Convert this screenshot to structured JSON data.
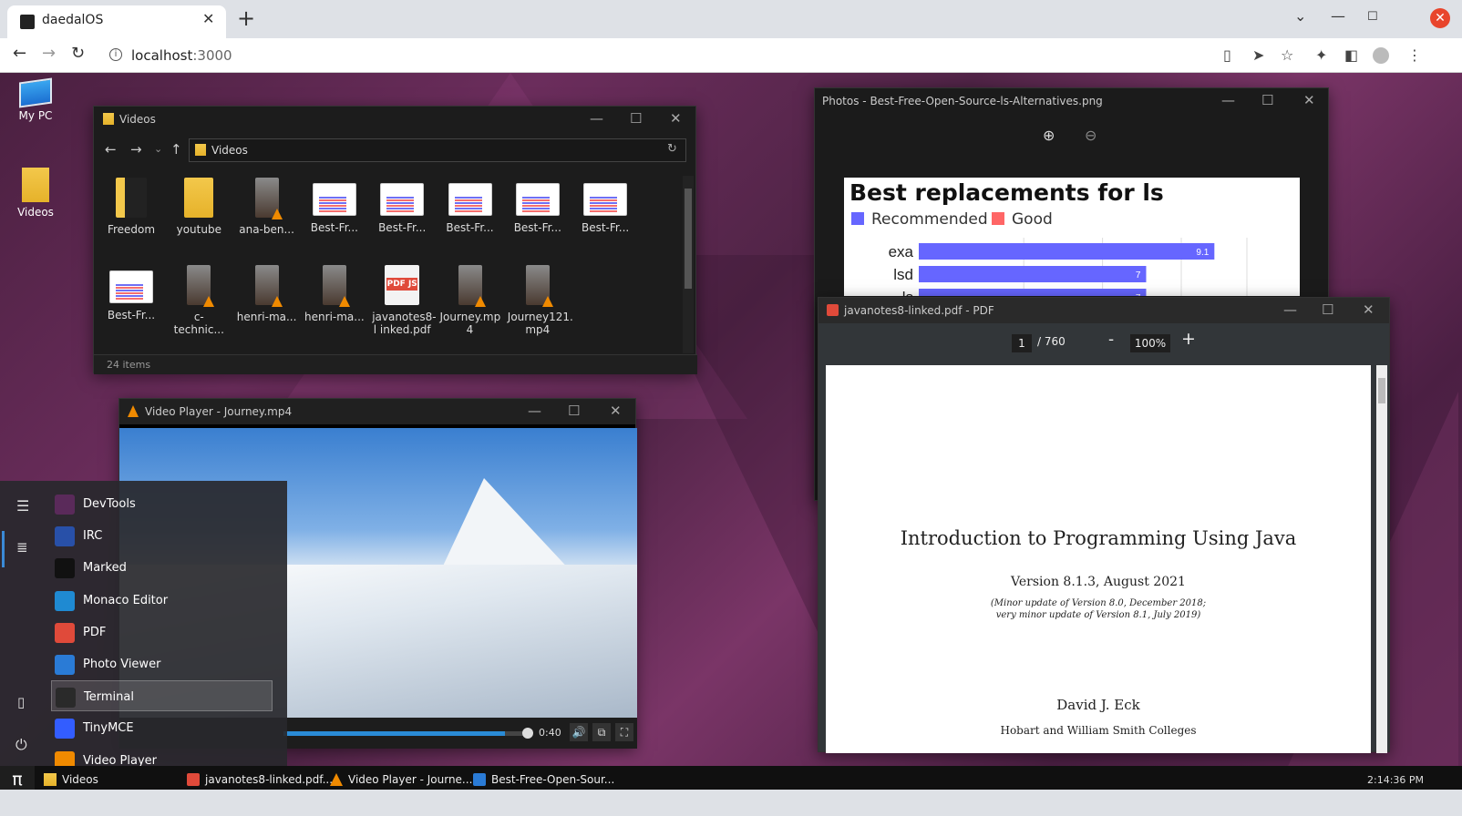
{
  "browser": {
    "tab_title": "daedalOS",
    "url_host": "localhost",
    "url_port": ":3000"
  },
  "desktop_icons": [
    {
      "label": "My PC"
    },
    {
      "label": "Videos"
    }
  ],
  "explorer": {
    "title": "Videos",
    "path": "Videos",
    "status": "24 items",
    "items": [
      {
        "label": "Freedom"
      },
      {
        "label": "youtube"
      },
      {
        "label": "ana-ben..."
      },
      {
        "label": "Best-Fr..."
      },
      {
        "label": "Best-Fr..."
      },
      {
        "label": "Best-Fr..."
      },
      {
        "label": "Best-Fr..."
      },
      {
        "label": "Best-Fr..."
      },
      {
        "label": "Best-Fr..."
      },
      {
        "label": "c-technic..."
      },
      {
        "label": "henri-ma..."
      },
      {
        "label": "henri-ma..."
      },
      {
        "label": "javanotes8-l inked.pdf"
      },
      {
        "label": "Journey.mp 4"
      },
      {
        "label": "Journey121. mp4"
      }
    ]
  },
  "photos": {
    "title": "Photos - Best-Free-Open-Source-ls-Alternatives.png",
    "chart_title": "Best replacements for ls",
    "legend": [
      "Recommended",
      "Good"
    ]
  },
  "chart_data": {
    "type": "bar",
    "title": "Best replacements for ls",
    "categories": [
      "exa",
      "lsd",
      "ls"
    ],
    "series": [
      {
        "name": "Recommended",
        "values": [
          9.1,
          7,
          7
        ]
      }
    ],
    "legend": [
      "Recommended",
      "Good"
    ]
  },
  "pdf": {
    "title": "javanotes8-linked.pdf - PDF",
    "page": "1",
    "page_total": "/ 760",
    "zoom": "100%",
    "minus": "-",
    "plus": "+",
    "doc_title": "Introduction to Programming Using Java",
    "version": "Version 8.1.3, August 2021",
    "note1": "(Minor update of Version 8.0, December 2018;",
    "note2": "very minor update of Version 8.1, July 2019)",
    "author": "David J. Eck",
    "college": "Hobart and William Smith Colleges"
  },
  "video": {
    "title": "Video Player - Journey.mp4",
    "time": "0:40",
    "progress": 0.9
  },
  "startmenu": {
    "items": [
      {
        "label": "DevTools",
        "color": "#5a2a5a"
      },
      {
        "label": "IRC",
        "color": "#2850a8"
      },
      {
        "label": "Marked",
        "color": "#111111"
      },
      {
        "label": "Monaco Editor",
        "color": "#1f8ad2"
      },
      {
        "label": "PDF",
        "color": "#e04a3a"
      },
      {
        "label": "Photo Viewer",
        "color": "#2a7bd6"
      },
      {
        "label": "Terminal",
        "color": "#2a2a2a"
      },
      {
        "label": "TinyMCE",
        "color": "#335dff"
      },
      {
        "label": "Video Player",
        "color": "#f08a00"
      }
    ]
  },
  "taskbar": {
    "start_glyph": "π",
    "entries": [
      {
        "label": "Videos"
      },
      {
        "label": "javanotes8-linked.pdf..."
      },
      {
        "label": "Video Player - Journe..."
      },
      {
        "label": "Best-Free-Open-Sour..."
      }
    ],
    "clock": "2:14:36 PM"
  }
}
